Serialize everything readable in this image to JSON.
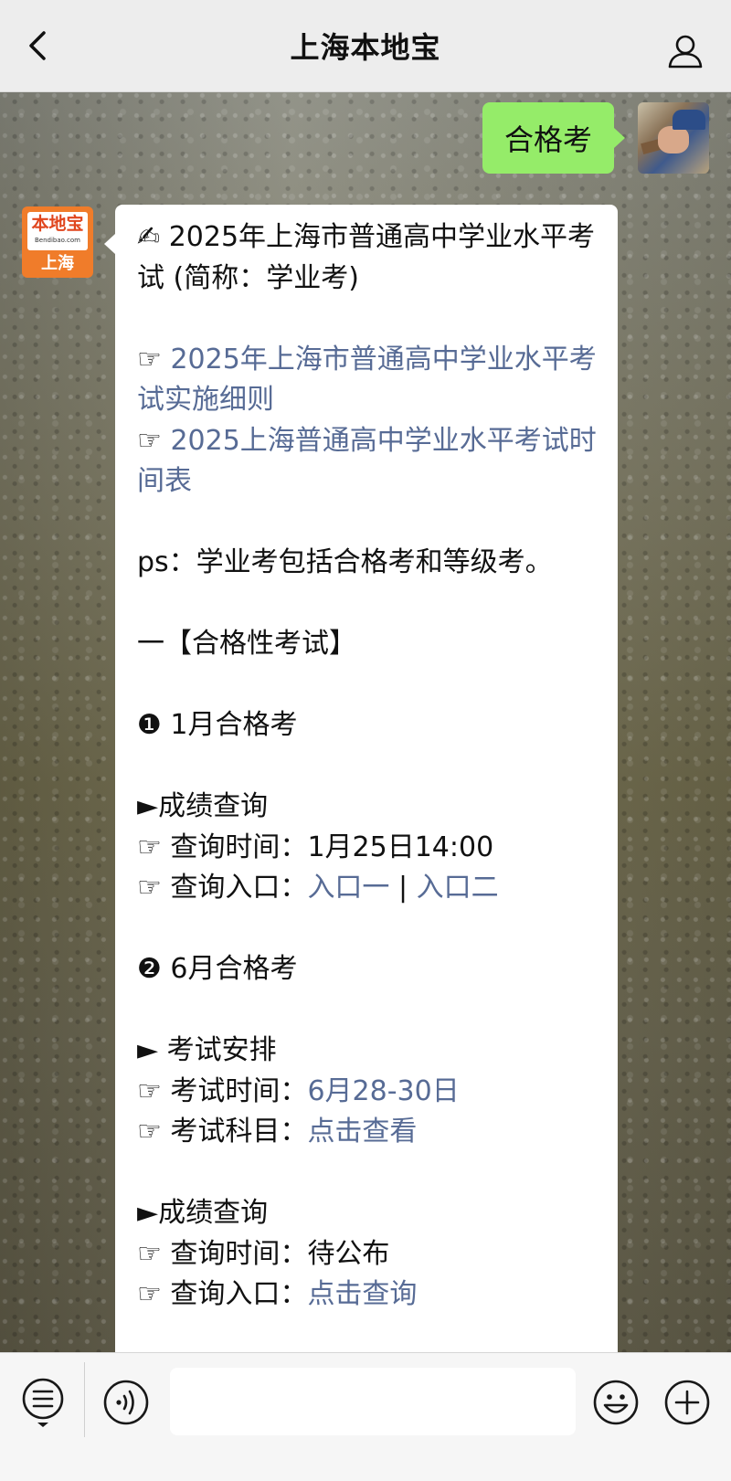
{
  "nav": {
    "title": "上海本地宝",
    "back_icon": "chevron-left-icon",
    "profile_icon": "user-icon"
  },
  "user_message": {
    "text": "合格考",
    "bubble_color": "#95ec69"
  },
  "bot_avatar": {
    "logo": "本地宝",
    "url": "Bendibao.com",
    "city": "上海",
    "color": "#f07c2a"
  },
  "bot_message": {
    "title_icon": "✍",
    "title": "2025年上海市普通高中学业水平考试 (简称：学业考)",
    "links": [
      {
        "bullet": "☞",
        "text": "2025年上海市普通高中学业水平考试实施细则"
      },
      {
        "bullet": "☞",
        "text": "2025上海普通高中学业水平考试时间表"
      }
    ],
    "note": "ps：学业考包括合格考和等级考。",
    "section_heading": "一【合格性考试】",
    "jan": {
      "heading": "❶ 1月合格考",
      "results_heading": "►成绩查询",
      "query_time_label": "☞ 查询时间：",
      "query_time_value": "1月25日14:00",
      "entry_label": "☞ 查询入口：",
      "entry_link_1": "入口一",
      "separator": " | ",
      "entry_link_2": "入口二"
    },
    "jun": {
      "heading": "❷ 6月合格考",
      "arrangement_heading": "► 考试安排",
      "exam_time_label": "☞ 考试时间：",
      "exam_time_value": "6月28-30日",
      "subjects_label": "☞ 考试科目：",
      "subjects_link": "点击查看",
      "results_heading": "►成绩查询",
      "query_time_label": "☞ 查询时间：",
      "query_time_value": "待公布",
      "entry_label": "☞ 查询入口：",
      "entry_link": "点击查询"
    },
    "link_color": "#576b95"
  },
  "toolbar": {
    "menu_icon": "menu-icon",
    "voice_icon": "voice-icon",
    "emoji_icon": "emoji-icon",
    "plus_icon": "plus-icon"
  }
}
